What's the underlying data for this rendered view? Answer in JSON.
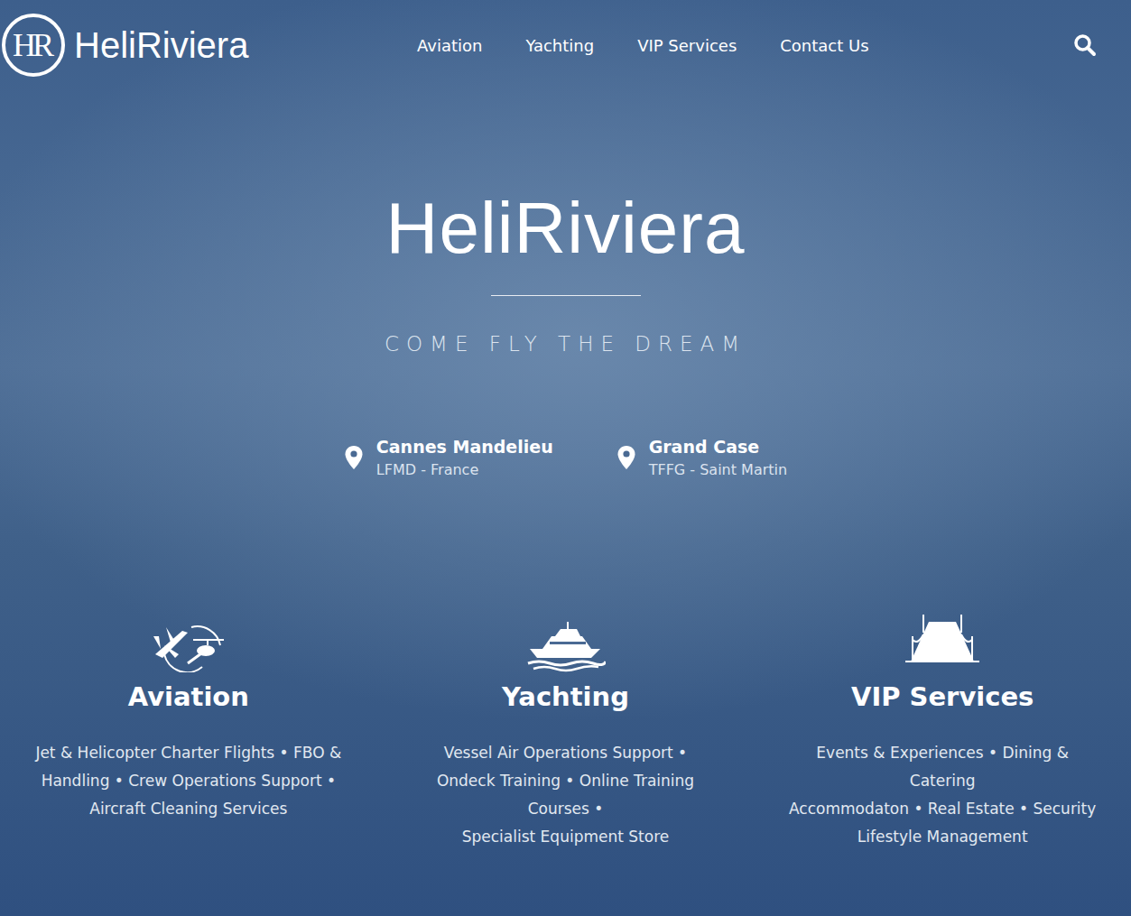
{
  "logo": {
    "mark": "HR",
    "text": "HeliRiviera"
  },
  "nav": {
    "items": [
      {
        "label": "Aviation"
      },
      {
        "label": "Yachting"
      },
      {
        "label": "VIP Services"
      },
      {
        "label": "Contact Us"
      }
    ]
  },
  "hero": {
    "title": "HeliRiviera",
    "tagline": "COME FLY THE DREAM"
  },
  "locations": [
    {
      "name": "Cannes Mandelieu",
      "detail": "LFMD - France"
    },
    {
      "name": "Grand Case",
      "detail": "TFFG - Saint Martin"
    }
  ],
  "services": [
    {
      "kind": "aviation",
      "title": "Aviation",
      "lines": [
        "Jet & Helicopter Charter Flights • FBO &",
        "Handling • Crew Operations Support •",
        "Aircraft Cleaning Services"
      ]
    },
    {
      "kind": "yachting",
      "title": "Yachting",
      "lines": [
        "Vessel Air Operations Support •",
        "Ondeck Training • Online Training",
        "Courses •",
        "Specialist Equipment Store"
      ]
    },
    {
      "kind": "vip",
      "title": "VIP Services",
      "lines": [
        "Events & Experiences • Dining &",
        "Catering",
        "Accommodaton • Real Estate • Security",
        "Lifestyle Management"
      ]
    }
  ]
}
